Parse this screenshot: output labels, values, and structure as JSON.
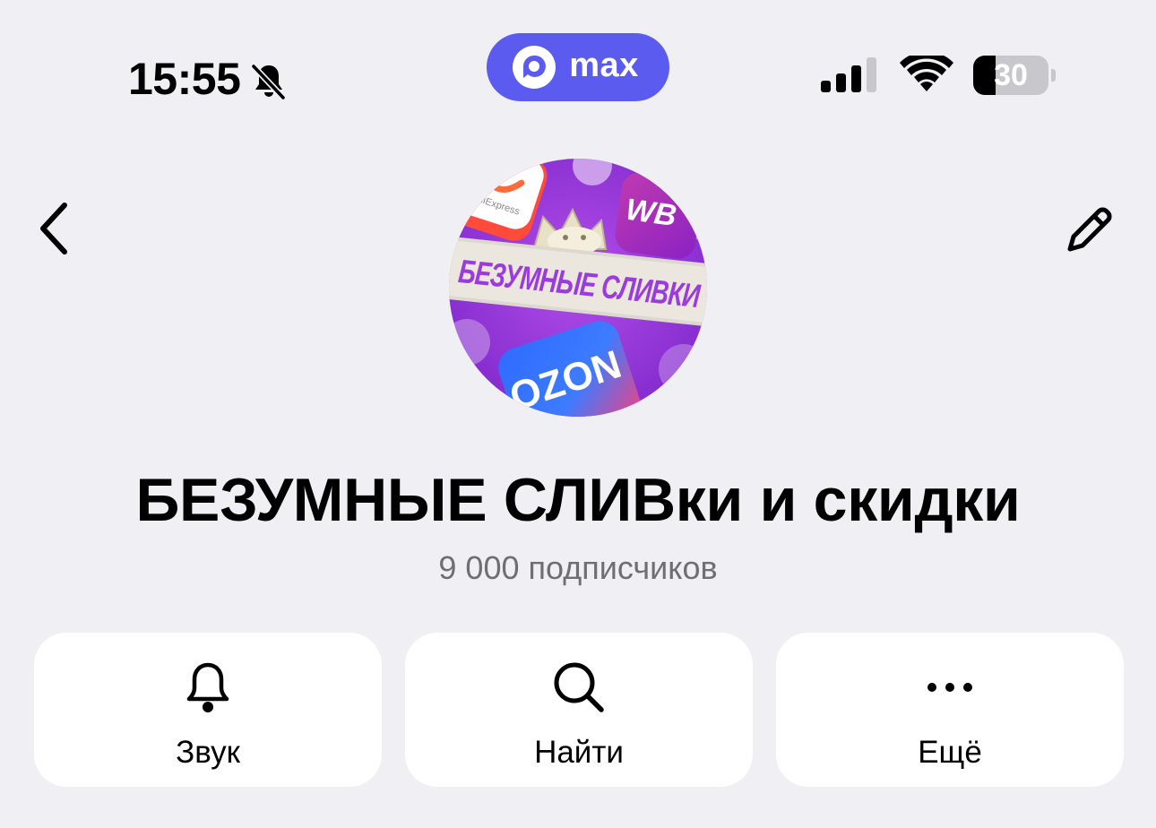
{
  "status_bar": {
    "time": "15:55",
    "battery_level": "30",
    "battery_fraction": 0.3
  },
  "app_pill": {
    "name": "max"
  },
  "avatar": {
    "banner_text": "БЕЗУМНЫЕ СЛИВКИ",
    "badge_wb": "WB",
    "badge_ozon": "OZON",
    "badge_ali": "AliExpress"
  },
  "channel": {
    "title": "БЕЗУМНЫЕ СЛИВки и скидки",
    "subscribers": "9 000 подписчиков"
  },
  "actions": [
    {
      "label": "Звук",
      "icon": "bell-icon"
    },
    {
      "label": "Найти",
      "icon": "search-icon"
    },
    {
      "label": "Ещё",
      "icon": "more-icon"
    }
  ],
  "colors": {
    "background": "#efeff4",
    "accent": "#5b5bf0",
    "card": "#ffffff",
    "secondary_text": "#6e6e73"
  }
}
